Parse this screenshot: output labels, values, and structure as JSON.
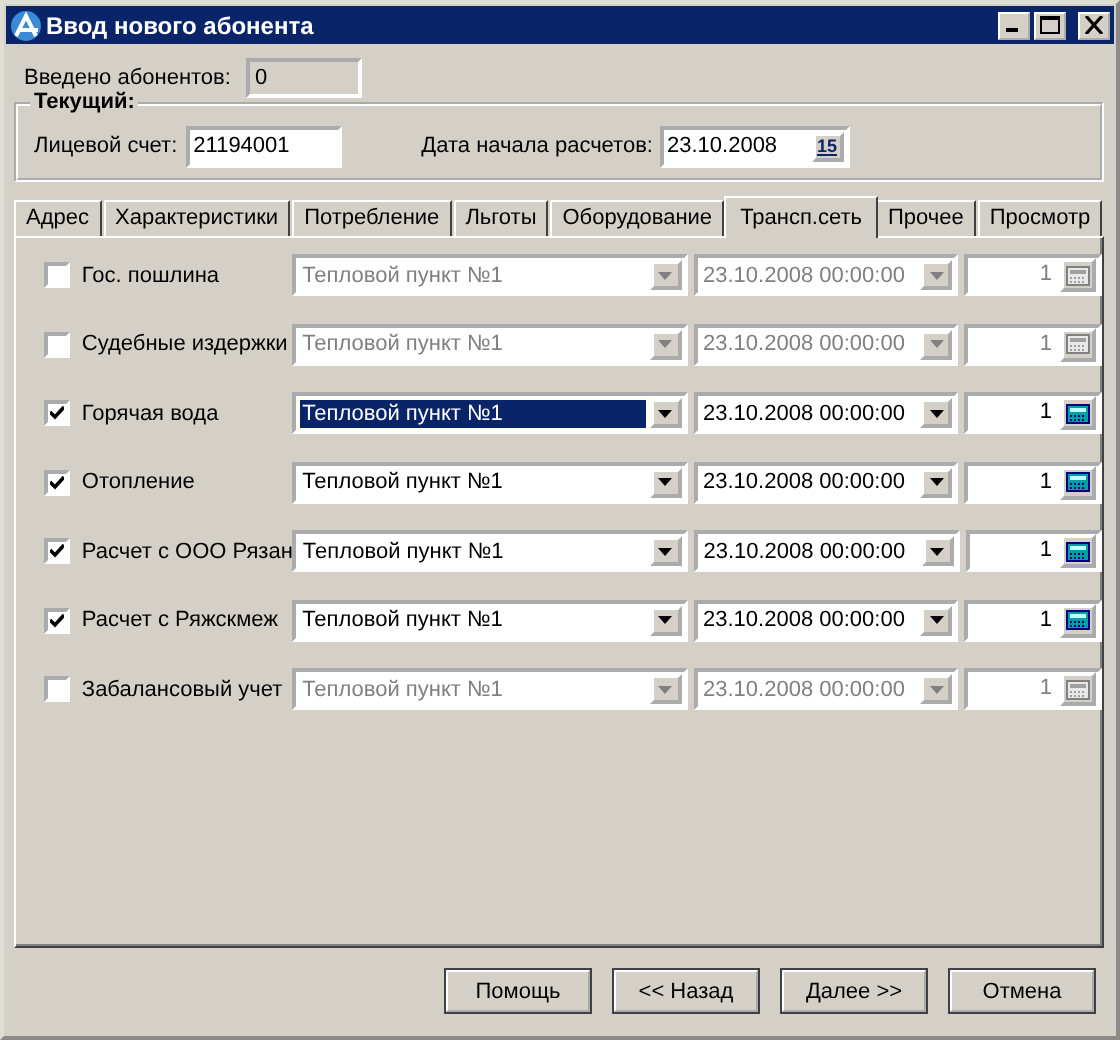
{
  "window": {
    "title": "Ввод нового абонента"
  },
  "entered": {
    "label": "Введено абонентов:",
    "value": "0"
  },
  "current": {
    "title": "Текущий:",
    "account_label": "Лицевой счет:",
    "account_value": "21194001",
    "date_label": "Дата начала расчетов:",
    "date_value": "23.10.2008",
    "calendar_button": "15"
  },
  "tabs": [
    {
      "label": "Адрес",
      "selected": false
    },
    {
      "label": "Характеристики",
      "selected": false
    },
    {
      "label": "Потребление",
      "selected": false
    },
    {
      "label": "Льготы",
      "selected": false
    },
    {
      "label": "Оборудование",
      "selected": false
    },
    {
      "label": "Трансп.сеть",
      "selected": true
    },
    {
      "label": "Прочее",
      "selected": false
    },
    {
      "label": "Просмотр",
      "selected": false
    }
  ],
  "rows": [
    {
      "label": "Гос. пошлина",
      "checked": false,
      "focused": false,
      "point": "Тепловой пункт №1",
      "date": "23.10.2008 00:00:00",
      "count": "1"
    },
    {
      "label": "Судебные издержки",
      "checked": false,
      "focused": false,
      "point": "Тепловой пункт №1",
      "date": "23.10.2008 00:00:00",
      "count": "1"
    },
    {
      "label": "Горячая вода",
      "checked": true,
      "focused": true,
      "point": "Тепловой пункт №1",
      "date": "23.10.2008 00:00:00",
      "count": "1"
    },
    {
      "label": "Отопление",
      "checked": true,
      "focused": false,
      "point": "Тепловой пункт №1",
      "date": "23.10.2008 00:00:00",
      "count": "1"
    },
    {
      "label": "Расчет с ООО Рязан",
      "checked": true,
      "focused": false,
      "point": "Тепловой пункт №1",
      "date": "23.10.2008 00:00:00",
      "count": "1"
    },
    {
      "label": "Расчет с Ряжскмеж",
      "checked": true,
      "focused": false,
      "point": "Тепловой пункт №1",
      "date": "23.10.2008 00:00:00",
      "count": "1"
    },
    {
      "label": "Забалансовый учет",
      "checked": false,
      "focused": false,
      "point": "Тепловой пункт №1",
      "date": "23.10.2008 00:00:00",
      "count": "1"
    }
  ],
  "buttons": [
    "Помощь",
    "<< Назад",
    "Далее >>",
    "Отмена"
  ]
}
